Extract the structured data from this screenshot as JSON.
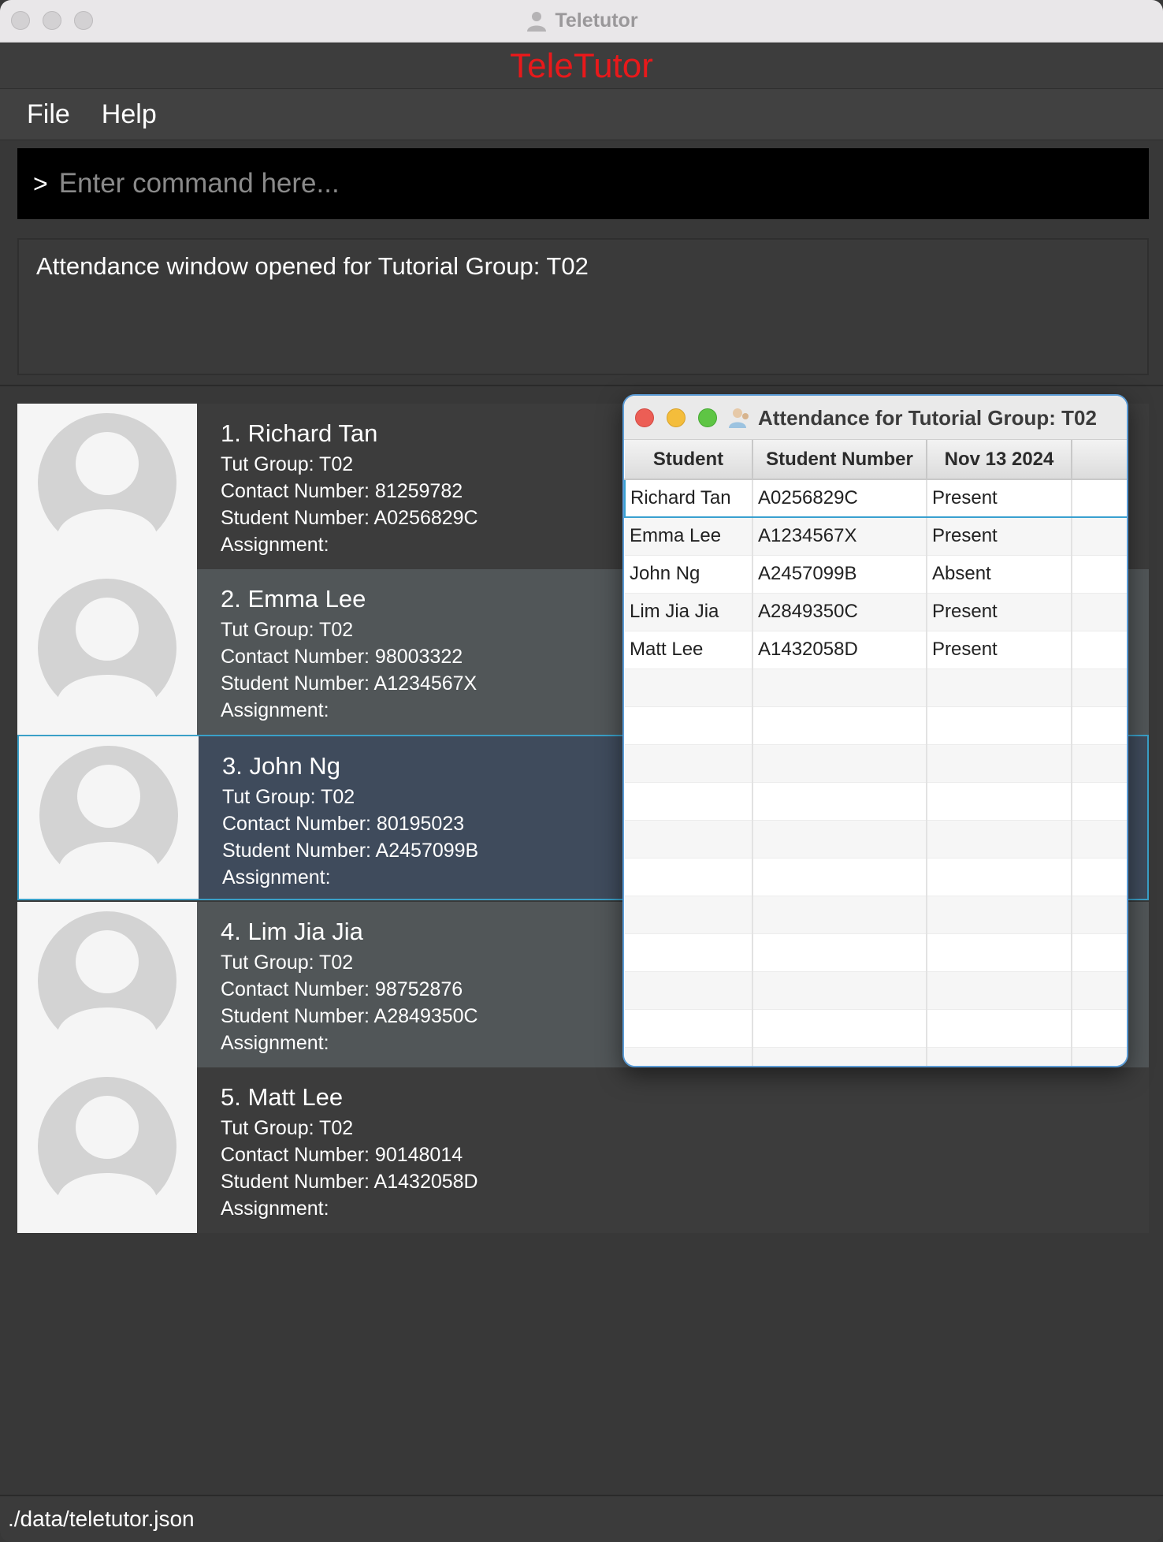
{
  "window": {
    "title": "Teletutor"
  },
  "banner": {
    "text": "TeleTutor",
    "color": "#e8191b"
  },
  "menu": {
    "items": [
      "File",
      "Help"
    ]
  },
  "command": {
    "prompt": ">",
    "placeholder": "Enter command here..."
  },
  "result": {
    "message": "Attendance window opened for Tutorial Group: T02"
  },
  "persons": [
    {
      "name": "1. Richard Tan",
      "group": "Tut Group: T02",
      "contact": "Contact Number: 81259782",
      "student": "Student Number: A0256829C",
      "assignment": "Assignment:"
    },
    {
      "name": "2. Emma Lee",
      "group": "Tut Group: T02",
      "contact": "Contact Number: 98003322",
      "student": "Student Number: A1234567X",
      "assignment": "Assignment:"
    },
    {
      "name": "3. John Ng",
      "group": "Tut Group: T02",
      "contact": "Contact Number: 80195023",
      "student": "Student Number: A2457099B",
      "assignment": "Assignment:"
    },
    {
      "name": "4. Lim Jia Jia",
      "group": "Tut Group: T02",
      "contact": "Contact Number: 98752876",
      "student": "Student Number: A2849350C",
      "assignment": "Assignment:"
    },
    {
      "name": "5. Matt Lee",
      "group": "Tut Group: T02",
      "contact": "Contact Number: 90148014",
      "student": "Student Number: A1432058D",
      "assignment": "Assignment:"
    }
  ],
  "attendance": {
    "title": "Attendance for Tutorial Group: T02",
    "headers": [
      "Student",
      "Student Number",
      "Nov 13 2024",
      ""
    ],
    "rows": [
      [
        "Richard Tan",
        "A0256829C",
        "Present",
        ""
      ],
      [
        "Emma Lee",
        "A1234567X",
        "Present",
        ""
      ],
      [
        "John Ng",
        "A2457099B",
        "Absent",
        ""
      ],
      [
        "Lim Jia Jia",
        "A2849350C",
        "Present",
        ""
      ],
      [
        "Matt Lee",
        "A1432058D",
        "Present",
        ""
      ]
    ]
  },
  "status": {
    "path": "./data/teletutor.json"
  }
}
